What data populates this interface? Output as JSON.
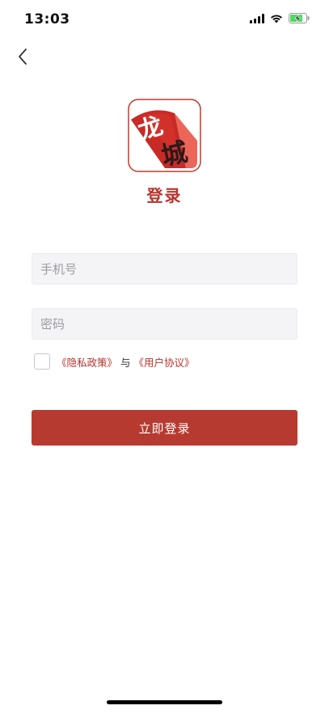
{
  "status_bar": {
    "time": "13:03",
    "icons": [
      "cellular-signal-icon",
      "wifi-icon",
      "battery-charging-icon"
    ],
    "battery_color": "#4cd964"
  },
  "nav": {
    "back_icon": "chevron-left-icon"
  },
  "brand": {
    "logo_text": "龙城",
    "app_name": "登录",
    "accent_color": "#b8332c"
  },
  "form": {
    "phone_placeholder": "手机号",
    "phone_value": "",
    "password_placeholder": "密码",
    "password_value": "",
    "agreement_checked": false,
    "privacy_link": "《隐私政策》",
    "conjunction": "与",
    "user_agreement_link": "《用户协议》",
    "login_label": "立即登录"
  }
}
